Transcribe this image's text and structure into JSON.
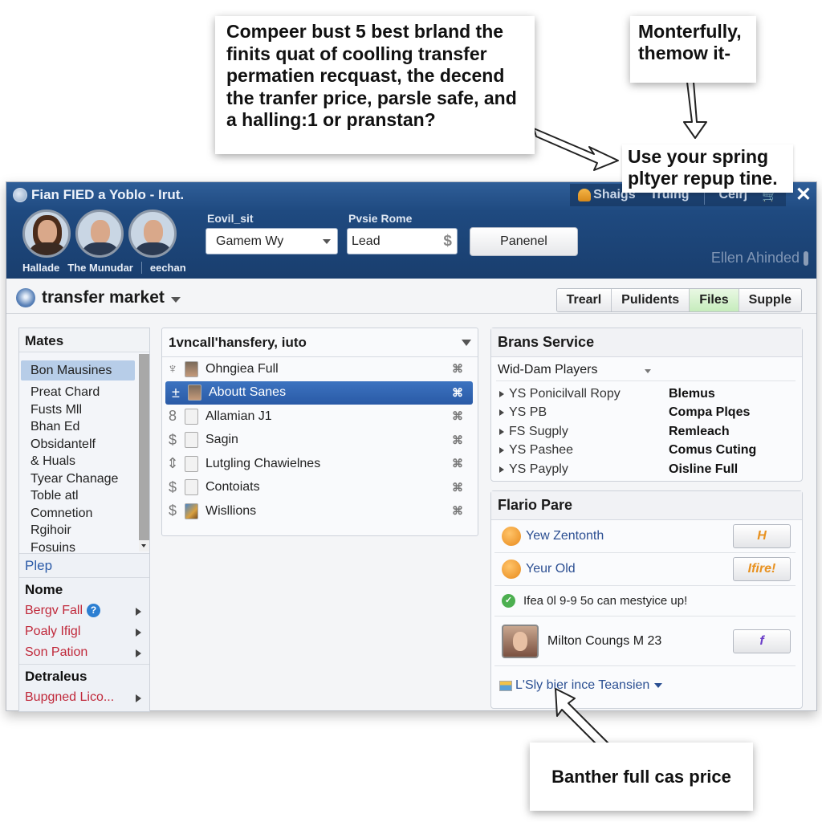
{
  "callouts": {
    "top_left": "Compeer bust 5 best brland the finits quat of coolling transfer permatien recquast, the decend the tranfer price, parsle safe, and a halling:1 or pranstan?",
    "top_right": "Monterfully, themow it-",
    "middle_right": "Use your spring pltyer repup tine.",
    "bottom": "Banther full cas price"
  },
  "window": {
    "title": "Fian FIED a Yoblo - Irut.",
    "top_right": {
      "item1": "Shaigs",
      "item2": "Truing",
      "item3": "Ceirj"
    },
    "avatars": [
      {
        "name": "Hallade"
      },
      {
        "name": "The Munudar"
      },
      {
        "name": "eechan"
      }
    ],
    "field1": {
      "label": "Eovil_sit",
      "value": "Gamem Wy"
    },
    "field2": {
      "label": "Pvsie Rome",
      "value": "Lead",
      "suffix": "$"
    },
    "primary_button": "Panenel",
    "user_name": "Ellen Ahinded"
  },
  "page": {
    "title": "transfer market",
    "tabs": [
      {
        "label": "Trearl",
        "active": false
      },
      {
        "label": "Pulidents",
        "active": false
      },
      {
        "label": "Files",
        "active": true
      },
      {
        "label": "Supple",
        "active": false
      }
    ]
  },
  "leftnav": {
    "header": "Mates",
    "items": [
      "Bon Mausines",
      "Preat Chard",
      "Fusts Mll",
      "Bhan Ed",
      "Obsidantelf",
      "& Huals",
      "Tyear Chanage",
      "Toble atl",
      "Comnetion",
      "Rgihoir",
      "Fosuins"
    ],
    "selected_index": 0,
    "link": "Plep",
    "section1": "Nome",
    "section1_items": [
      "Bergv Fall",
      "Poaly Ifigl",
      "Son Pation"
    ],
    "section2": "Detraleus",
    "section2_items": [
      "Bupgned Lico..."
    ]
  },
  "midlist": {
    "header": "1vncall'hansfery, iuto",
    "rows": [
      {
        "lead": "♆",
        "label": "Ohngiea Full",
        "cmd": "⌘",
        "thumb": "photo",
        "selected": false
      },
      {
        "lead": "±",
        "label": "Aboutt Sanes",
        "cmd": "⌘",
        "thumb": "photo",
        "selected": true
      },
      {
        "lead": "8",
        "label": "Allamian J1",
        "cmd": "⌘",
        "thumb": "doc",
        "selected": false
      },
      {
        "lead": "$",
        "label": "Sagin",
        "cmd": "⌘",
        "thumb": "doc",
        "selected": false
      },
      {
        "lead": "⇕",
        "label": "Lutgling Chawielnes",
        "cmd": "⌘",
        "thumb": "doc",
        "selected": false
      },
      {
        "lead": "$",
        "label": "Contoiats",
        "cmd": "⌘",
        "thumb": "doc",
        "selected": false
      },
      {
        "lead": "$",
        "label": "Wisllions",
        "cmd": "⌘",
        "thumb": "img",
        "selected": false
      }
    ]
  },
  "service": {
    "header": "Brans Service",
    "dropdown": "Wid-Dam Players",
    "rows": [
      {
        "key": "YS Ponicilvall Ropy",
        "value": "Blemus"
      },
      {
        "key": "YS PB",
        "value": "Compa Plqes"
      },
      {
        "key": "FS Sugply",
        "value": "Remleach"
      },
      {
        "key": "YS Pashee",
        "value": "Comus Cuting"
      },
      {
        "key": "YS Payply",
        "value": "Oisline Full"
      }
    ]
  },
  "profile": {
    "header": "Flario Pare",
    "item1": {
      "label": "Yew Zentonth",
      "button": "H"
    },
    "item2": {
      "label": "Yeur Old",
      "button": "Ifire!"
    },
    "message": "Ifea 0l 9-9 5o can mestyice up!",
    "user": {
      "label": "Milton Coungs M 23",
      "button": "f"
    },
    "footer_link": "L'Sly bier ince Teansien"
  }
}
